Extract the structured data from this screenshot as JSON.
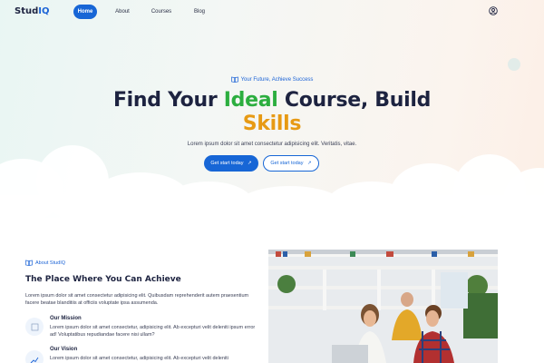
{
  "brand": {
    "name_prefix": "Stud",
    "name_accent": "IQ"
  },
  "nav": {
    "items": [
      {
        "label": "Home",
        "active": true
      },
      {
        "label": "About",
        "active": false
      },
      {
        "label": "Courses",
        "active": false
      },
      {
        "label": "Blog",
        "active": false
      }
    ],
    "user_icon": "user-circle-icon"
  },
  "hero": {
    "tagline": "Your Future, Achieve Success",
    "headline_part1": "Find Your ",
    "headline_highlight1": "Ideal",
    "headline_part2": " Course, Build",
    "headline_highlight2": "Skills",
    "subtitle": "Lorem ipsum dolor sit amet consectetur adipisicing elit. Veritatis, vitae.",
    "primary_button": "Get start today",
    "secondary_button": "Get start today",
    "button_icon": "arrow-up-right-icon"
  },
  "about": {
    "tag": "About StudIQ",
    "title": "The Place Where You Can Achieve",
    "text": "Lorem ipsum dolor sit amet consectetur adipisicing elit. Quibusdam reprehenderit autem praesentium facere beatae blanditiis at officiis voluptate ipsa assumenda.",
    "features": [
      {
        "title": "Our Mission",
        "text": "Lorem ipsum dolor sit amet consectetur, adipisicing elit. Ab excepturi velit deleniti ipsum error ad! Voluptatibus repudiandae facere nisi ullam?",
        "icon": "mission-icon"
      },
      {
        "title": "Our Vision",
        "text": "Lorem ipsum dolor sit amet consectetur, adipisicing elit. Ab excepturi velit deleniti",
        "icon": "vision-chart-icon"
      }
    ]
  },
  "colors": {
    "primary": "#1766d6",
    "green": "#2cae3f",
    "orange": "#e79a14",
    "dark": "#1d2340"
  }
}
